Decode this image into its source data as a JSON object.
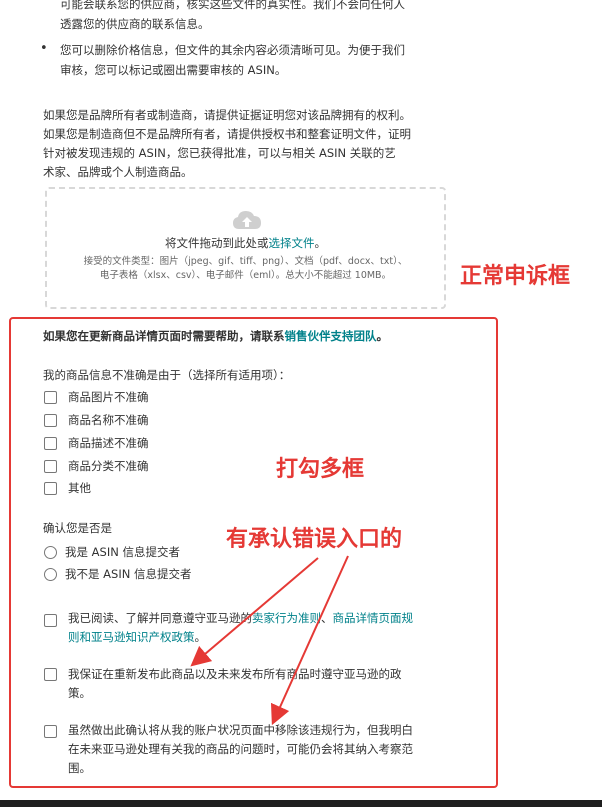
{
  "intro": {
    "line_top_1": "可能会联系您的供应商，核实这些文件的真实性。我们不会向任何人",
    "line_top_2": "透露您的供应商的联系信息。",
    "bullet_1": "您可以删除价格信息，但文件的其余内容必须清晰可见。为便于我们",
    "bullet_2": "审核，您可以标记或圈出需要审核的 ASIN。",
    "para_1": "如果您是品牌所有者或制造商，请提供证据证明您对该品牌拥有的权利。",
    "para_2": "如果您是制造商但不是品牌所有者，请提供授权书和整套证明文件，证明",
    "para_3": "针对被发现违规的 ASIN，您已获得批准，可以与相关 ASIN 关联的艺",
    "para_4": "术家、品牌或个人制造商品。"
  },
  "upload": {
    "drag_text": "将文件拖动到此处或",
    "choose_link": "选择文件",
    "period": "。",
    "types_1": "接受的文件类型：图片（jpeg、gif、tiff、png）、文档（pdf、docx、txt）、",
    "types_2": "电子表格（xlsx、csv）、电子邮件（eml）。总大小不能超过 10MB。"
  },
  "annotations": {
    "normal_box": "正常申诉框",
    "checkboxes": "打勾多框",
    "admit_entry": "有承认错误入口的"
  },
  "form": {
    "help_prefix": "如果您在更新商品详情页面时需要帮助，请联系",
    "help_link": "销售伙伴支持团队",
    "help_suffix": "。",
    "inaccurate_question": "我的商品信息不准确是由于（选择所有适用项）：",
    "options": [
      "商品图片不准确",
      "商品名称不准确",
      "商品描述不准确",
      "商品分类不准确",
      "其他"
    ],
    "submitter_question": "确认您是否是",
    "radio_1": "我是 ASIN 信息提交者",
    "radio_2": "我不是 ASIN 信息提交者",
    "confirm_1_prefix": "我已阅读、了解并同意遵守亚马逊的",
    "confirm_1_link1": "卖家行为准则",
    "confirm_1_sep": "、",
    "confirm_1_link2": "商品详情页面规",
    "confirm_1_link3": "则和亚马逊知识产权政策",
    "confirm_1_end": "。",
    "confirm_2_line1": "我保证在重新发布此商品以及未来发布所有商品时遵守亚马逊的政",
    "confirm_2_line2": "策。",
    "confirm_3_line1": "虽然做出此确认将从我的账户状况页面中移除该违规行为，但我明白",
    "confirm_3_line2": "在未来亚马逊处理有关我的商品的问题时，可能仍会将其纳入考察范",
    "confirm_3_line3": "围。"
  },
  "colors": {
    "annotation": "#e53935",
    "link": "#00818a"
  }
}
